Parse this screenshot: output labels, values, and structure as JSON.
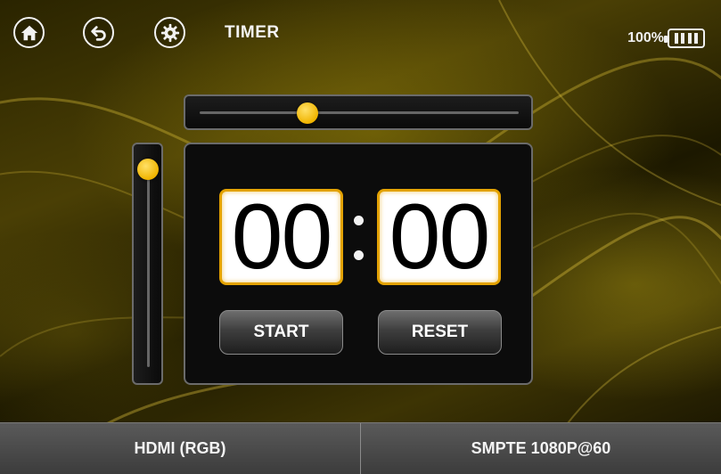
{
  "header": {
    "title": "TIMER",
    "battery_percent": "100%",
    "icons": {
      "home": "home-icon",
      "back": "undo-icon",
      "settings": "gear-icon",
      "battery": "battery-icon"
    }
  },
  "sliders": {
    "horizontal_level": 0.34,
    "vertical_level": 0.0
  },
  "timer": {
    "minutes": "00",
    "seconds": "00",
    "start_label": "START",
    "reset_label": "RESET"
  },
  "status_bar": {
    "input": "HDMI (RGB)",
    "format": "SMPTE 1080P@60"
  },
  "colors": {
    "accent": "#f0b400",
    "digit_border": "#e3a200"
  }
}
